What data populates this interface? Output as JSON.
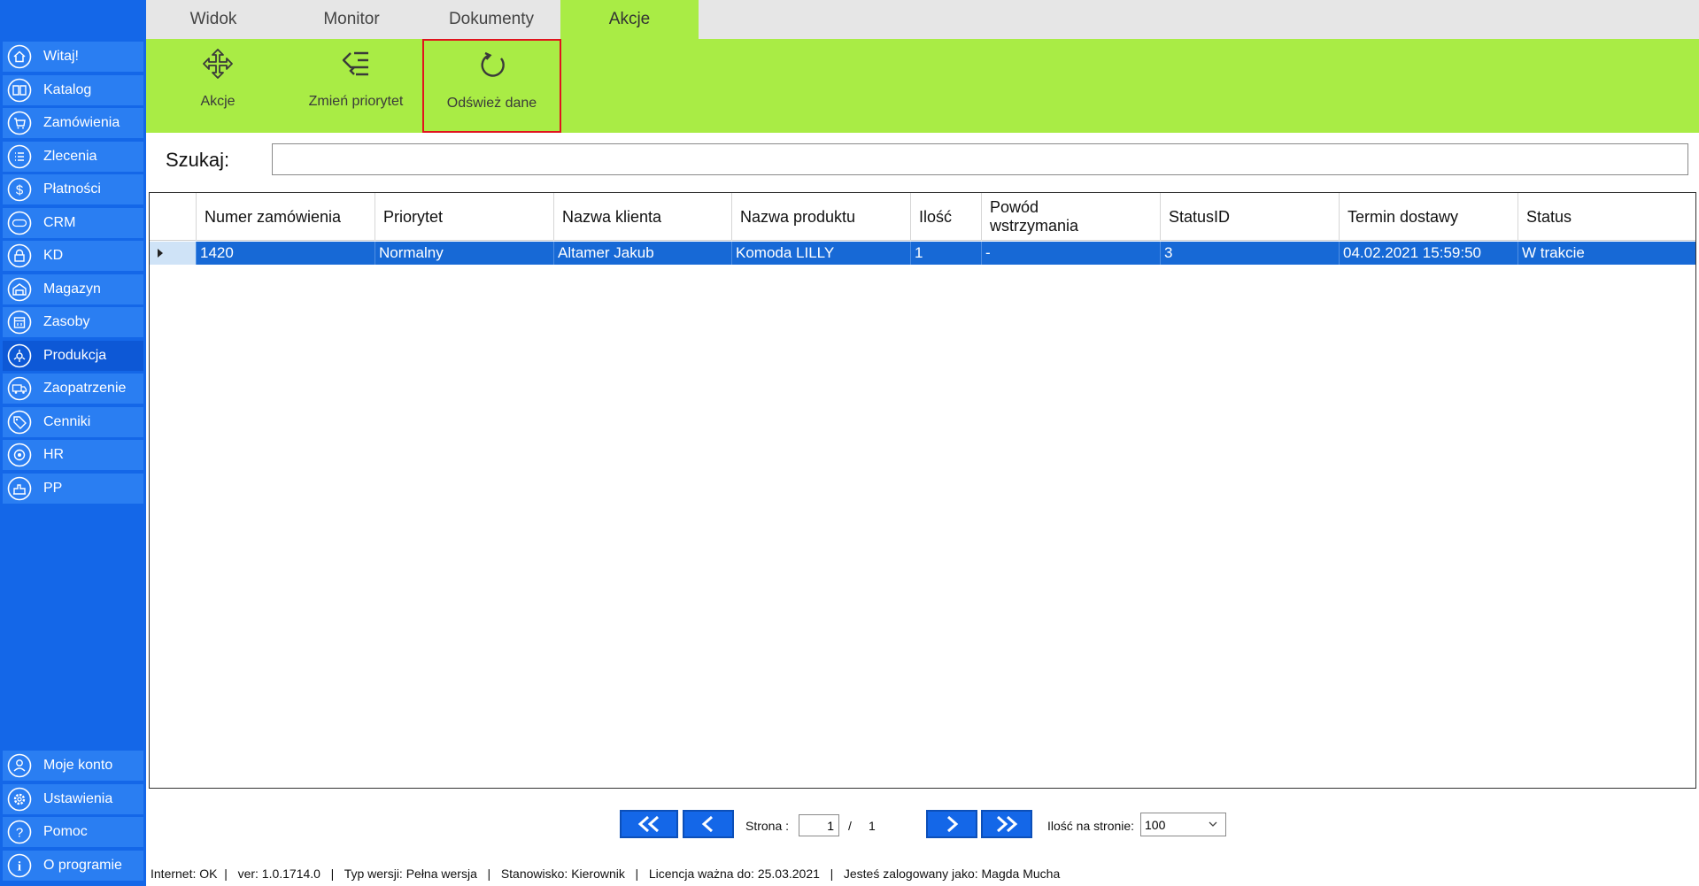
{
  "sidebar": {
    "items": [
      {
        "label": "Witaj!",
        "icon": "home-icon"
      },
      {
        "label": "Katalog",
        "icon": "book-icon"
      },
      {
        "label": "Zamówienia",
        "icon": "cart-icon"
      },
      {
        "label": "Zlecenia",
        "icon": "list-icon"
      },
      {
        "label": "Płatności",
        "icon": "dollar-icon"
      },
      {
        "label": "CRM",
        "icon": "crm-icon"
      },
      {
        "label": "KD",
        "icon": "lock-icon"
      },
      {
        "label": "Magazyn",
        "icon": "warehouse-icon"
      },
      {
        "label": "Zasoby",
        "icon": "calendar-icon"
      },
      {
        "label": "Produkcja",
        "icon": "factory-icon"
      },
      {
        "label": "Zaopatrzenie",
        "icon": "truck-icon"
      },
      {
        "label": "Cenniki",
        "icon": "tag-icon"
      },
      {
        "label": "HR",
        "icon": "people-icon"
      },
      {
        "label": "PP",
        "icon": "machine-icon"
      }
    ],
    "bottom_items": [
      {
        "label": "Moje konto",
        "icon": "user-icon"
      },
      {
        "label": "Ustawienia",
        "icon": "gear-icon"
      },
      {
        "label": "Pomoc",
        "icon": "help-icon"
      },
      {
        "label": "O programie",
        "icon": "info-icon"
      }
    ],
    "active_item": "Produkcja"
  },
  "tabs": [
    {
      "label": "Widok"
    },
    {
      "label": "Monitor"
    },
    {
      "label": "Dokumenty"
    },
    {
      "label": "Akcje"
    }
  ],
  "active_tab": "Akcje",
  "ribbon": {
    "buttons": [
      {
        "label": "Akcje",
        "icon": "move-arrows-icon"
      },
      {
        "label": "Zmień priorytet",
        "icon": "priority-list-icon"
      },
      {
        "label": "Odśwież dane",
        "icon": "refresh-icon"
      }
    ]
  },
  "search": {
    "label": "Szukaj:",
    "value": ""
  },
  "grid": {
    "columns": [
      "Numer zamówienia",
      "Priorytet",
      "Nazwa klienta",
      "Nazwa produktu",
      "Ilość",
      "Powód wstrzymania",
      "StatusID",
      "Termin dostawy",
      "Status"
    ],
    "rows": [
      [
        "1420",
        "Normalny",
        "Altamer Jakub",
        "Komoda LILLY",
        "1",
        "-",
        "3",
        "04.02.2021 15:59:50",
        "W trakcie"
      ]
    ]
  },
  "pager": {
    "page_label": "Strona :",
    "current_page": "1",
    "separator": "/",
    "total_pages": "1",
    "per_page_label": "Ilość na stronie:",
    "per_page_value": "100"
  },
  "statusbar": {
    "text": "Internet: OK  |   ver: 1.0.1714.0   |   Typ wersji: Pełna wersja   |   Stanowisko: Kierownik   |   Licencja ważna do: 25.03.2021   |   Jesteś zalogowany jako: Magda Mucha"
  },
  "colors": {
    "sidebar_bg": "#1467e8",
    "sidebar_item": "#2a7ef2",
    "ribbon_bg": "#a9ec45",
    "row_selected": "#1769d6",
    "highlight_border": "#e0141e"
  }
}
